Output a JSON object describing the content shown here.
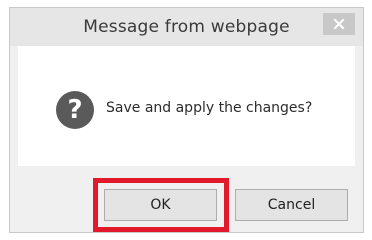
{
  "dialog": {
    "title": "Message from webpage",
    "message": "Save and apply the changes?",
    "question_icon": "question-icon",
    "close_icon": "close-icon",
    "ok_label": "OK",
    "cancel_label": "Cancel",
    "highlight_color": "#e2182b"
  }
}
